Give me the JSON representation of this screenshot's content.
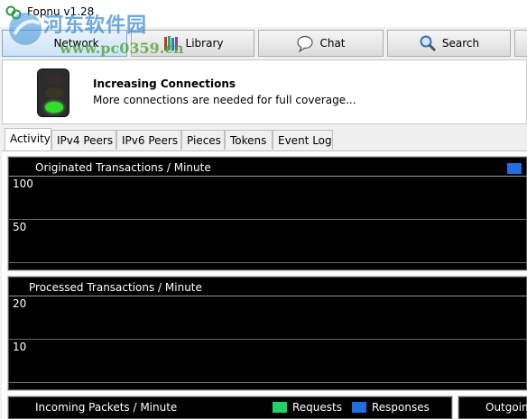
{
  "window": {
    "title": "Fopnu v1.28"
  },
  "watermark": {
    "text_cn": "河东软件园",
    "url": "www.pc0359.cn"
  },
  "toolbar": {
    "buttons": [
      {
        "label": "Network",
        "icon": "network-icon",
        "active": true
      },
      {
        "label": "Library",
        "icon": "books-icon",
        "active": false
      },
      {
        "label": "Chat",
        "icon": "chat-bubble-icon",
        "active": false
      },
      {
        "label": "Search",
        "icon": "magnifier-icon",
        "active": false
      }
    ]
  },
  "status": {
    "title": "Increasing Connections",
    "message": "More connections are needed for full coverage...",
    "light": "green"
  },
  "tabs": [
    "Activity",
    "IPv4 Peers",
    "IPv6 Peers",
    "Pieces",
    "Tokens",
    "Event Log"
  ],
  "active_tab": "Activity",
  "colors": {
    "requests": "#1fd26a",
    "responses": "#1f6fe0",
    "chart_bg": "#000000",
    "grid": "#6a6a6a"
  },
  "chart_data": [
    {
      "type": "line",
      "title": "Originated Transactions / Minute",
      "y_ticks": [
        "100",
        "50"
      ],
      "ylim": [
        0,
        100
      ],
      "series": [
        {
          "values": []
        }
      ]
    },
    {
      "type": "line",
      "title": "Processed Transactions / Minute",
      "y_ticks": [
        "20",
        "10"
      ],
      "ylim": [
        0,
        20
      ],
      "series": []
    },
    {
      "type": "line",
      "title": "Incoming Packets / Minute",
      "legend": [
        "Requests",
        "Responses"
      ],
      "series": [
        {
          "name": "Requests",
          "values": []
        },
        {
          "name": "Responses",
          "values": []
        }
      ]
    },
    {
      "type": "line",
      "title": "Outgoin",
      "series": []
    }
  ]
}
